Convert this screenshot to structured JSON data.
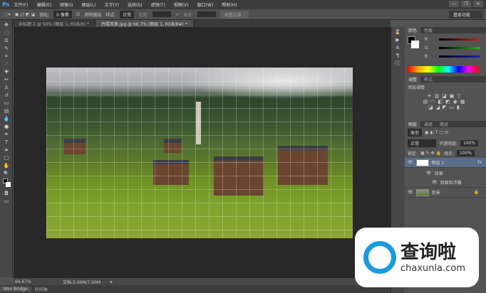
{
  "app": {
    "logo": "Ps"
  },
  "menu": [
    "文件(F)",
    "编辑(E)",
    "图像(I)",
    "图层(L)",
    "文字(Y)",
    "选择(S)",
    "滤镜(T)",
    "视图(V)",
    "窗口(W)",
    "帮助(H)"
  ],
  "window_controls": [
    "—",
    "❐",
    "✕"
  ],
  "options": {
    "feather_label": "羽化:",
    "feather_value": "0 像素",
    "antialias_label": "消除锯齿",
    "antialias_checked": true,
    "style_label": "样式:",
    "style_value": "正常",
    "width_label": "宽度:",
    "height_label": "高度:",
    "refine_edge": "调整边缘...",
    "workspace": "基本功能"
  },
  "tabs": [
    {
      "label": "未标题-1 @ 50% (图层 1, RGB/8) *",
      "active": false
    },
    {
      "label": "丹霞风景.jpg @ 66.7% (图层 1, RGB/8#) *",
      "active": true
    }
  ],
  "status": {
    "zoom": "66.67%",
    "doc": "文档:3.00M/7.00M"
  },
  "bottom_tabs": [
    "Mini Bridge",
    "时间轴"
  ],
  "color_panel": {
    "tabs": [
      "颜色",
      "色板"
    ],
    "channels": [
      "R",
      "G",
      "B"
    ],
    "colors": {
      "r": "#d02020",
      "g": "#20b020",
      "b": "#2020c0"
    }
  },
  "adjust_panel": {
    "tabs": [
      "调整",
      "样式"
    ],
    "title": "添加调整"
  },
  "layers_panel": {
    "tabs": [
      "图层",
      "通道",
      "路径"
    ],
    "filter": "类型",
    "blend": "正常",
    "opacity_label": "不透明度:",
    "opacity": "100%",
    "lock_label": "锁定:",
    "fill_label": "填充:",
    "fill": "100%",
    "layers": [
      {
        "name": "图层 1",
        "fx": "fx",
        "selected": true
      },
      {
        "name": "效果"
      },
      {
        "name": "斜面和浮雕"
      },
      {
        "name": "背景"
      }
    ]
  },
  "watermark": {
    "text": "查询啦",
    "url": "chaxunla.com"
  }
}
